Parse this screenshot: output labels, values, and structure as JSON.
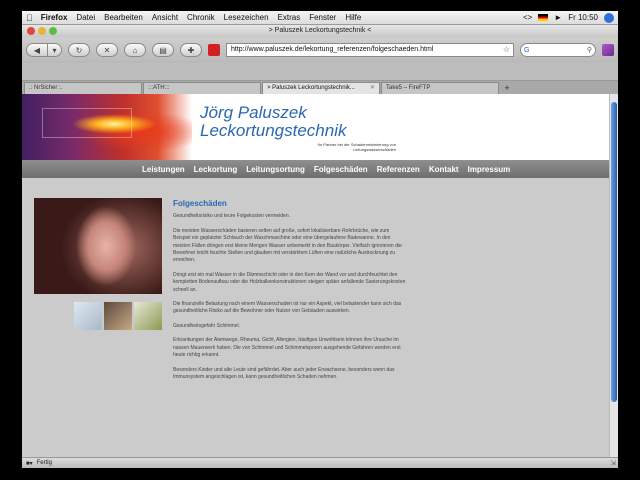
{
  "menubar": {
    "items": [
      "Firefox",
      "Datei",
      "Bearbeiten",
      "Ansicht",
      "Chronik",
      "Lesezeichen",
      "Extras",
      "Fenster",
      "Hilfe"
    ],
    "clock": "Fr 10:50"
  },
  "window": {
    "title": "> Paluszek Leckortungstechnik <"
  },
  "toolbar": {
    "url": "http://www.paluszek.de/lekortung_referenzen/folgeschaeden.html",
    "search_engine": "G"
  },
  "tabs": [
    {
      "label": ".: NrSicher :."
    },
    {
      "label": ":::ATH:::"
    },
    {
      "label": "> Paluszek Leckortungstechnik..."
    },
    {
      "label": "Take5 – FireFTP"
    }
  ],
  "site": {
    "title_line1": "Jörg Paluszek",
    "title_line2": "Leckortungstechnik",
    "subtitle": "Ihr Partner bei der Schadenminimierung von Leitungswasserschäden",
    "nav": [
      "Leistungen",
      "Leckortung",
      "Leitungsortung",
      "Folgeschäden",
      "Referenzen",
      "Kontakt",
      "Impressum"
    ]
  },
  "article": {
    "heading": "Folgeschäden",
    "paragraphs": [
      "Gesundheitsrisiko und teure Folgekosten vermeiden.",
      "Die meisten Wasserschäden basieren selten auf große, sofort lokalisierbare Rohrbrüche, wie zum Beispiel ein geplatzter Schlauch der Waschmaschine oder eine übergelaufene Badewanne. In den meisten Fällen dringen erst kleine Mengen Wasser unbemerkt in den Baukörper. Vielfach ignorieren die Bewohner leicht feuchte Stellen und glauben mit verstärktem Lüften eine natürliche Austrocknung zu erreichen.",
      "Dringt erst ein mal Wasser in die Dämmschicht oder in den Kern der Wand vor und durchfeuchtet den kompletten Bodenaufbau oder die Holzbalkenkonstruktionen steigen später anfallende Sanierungskosten schnell an.",
      "Die finanzielle Belastung nach einem Wasserschaden ist nur ein Aspekt, viel belastender kann sich das gesundheitliche Risiko auf die Bewohner oder Nutzer von Gebäuden auswirken.",
      "Gesundheitsgefahr Schimmel.",
      "Erkrankungen der Atemwege, Rheuma, Gicht, Allergien, häufiges Unwohlsein können ihre Ursache im nassen Mauerwerk haben. Die von Schimmel und Schimmelsporen ausgehende Gefahren werden erst heute richtig erkannt.",
      "Besonders Kinder und alte Leute sind gefährdet. Aber auch jeder Erwachsene, besonders wenn das Immunsystem angeschlagen ist, kann gesundheitlichen Schaden nehmen."
    ]
  },
  "status": {
    "text": "Fertig"
  }
}
